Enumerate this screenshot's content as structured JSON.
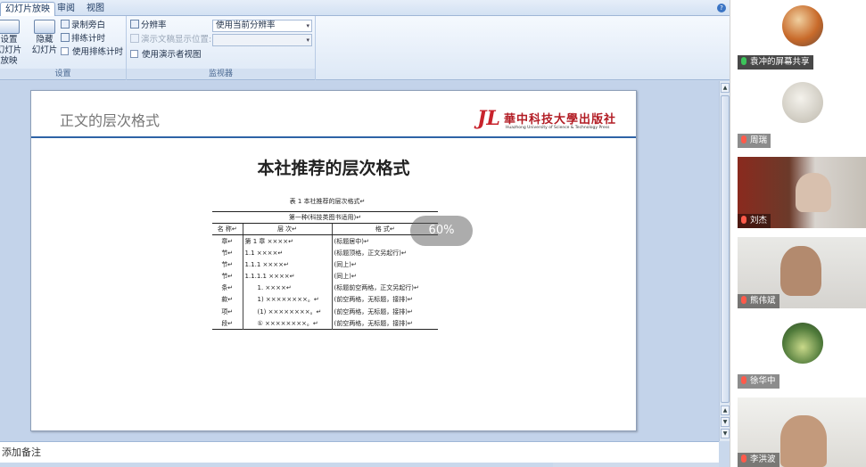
{
  "ribbon": {
    "tabs": [
      "幻灯片放映",
      "审阅",
      "视图"
    ],
    "help_label": "?",
    "setup_group": {
      "setup_show_label": "设置\n幻灯片放映",
      "hide_slide_label": "隐藏\n幻灯片",
      "record_narration": "录制旁白",
      "rehearse_timings": "排练计时",
      "use_rehearsed_timings": "使用排练计时",
      "group_label": "设置"
    },
    "monitor_group": {
      "resolution_label": "分辨率",
      "resolution_value": "使用当前分辨率",
      "show_on_label": "演示文稿显示位置:",
      "presenter_view_label": "使用演示者视图",
      "group_label": "监视器"
    }
  },
  "slide": {
    "header_title": "正文的层次格式",
    "logo_mark": "JL",
    "logo_cn": "華中科技大學出版社",
    "logo_en": "Huazhong University of Science & Technology Press",
    "main_title": "本社推荐的层次格式",
    "doc": {
      "caption": "表 1  本社推荐的层次格式↵",
      "span_row": "第一种(科技类图书适用)↵",
      "headers": [
        "名  称↵",
        "层  次↵",
        "格  式↵"
      ],
      "rows": [
        [
          "章↵",
          "第 1 章 ××××↵",
          "(标题居中)↵"
        ],
        [
          "节↵",
          "1.1 ××××↵",
          "(标题顶格，正文另起行)↵"
        ],
        [
          "节↵",
          "1.1.1 ××××↵",
          "(同上)↵"
        ],
        [
          "节↵",
          "1.1.1.1 ××××↵",
          "(同上)↵"
        ],
        [
          "条↵",
          "1. ××××↵",
          "(标题前空两格，正文另起行)↵"
        ],
        [
          "款↵",
          "1) ××××××××。↵",
          "(前空两格，无标题，接排)↵"
        ],
        [
          "项↵",
          "(1) ××××××××。↵",
          "(前空两格，无标题，接排)↵"
        ],
        [
          "段↵",
          "① ××××××××。↵",
          "(前空两格，无标题，接排)↵"
        ]
      ]
    },
    "zoom_badge": "60%"
  },
  "notes": {
    "placeholder": "添加备注"
  },
  "meeting": {
    "participants": [
      {
        "name": "袁冲的屏幕共享",
        "mic": "green",
        "sharing": true
      },
      {
        "name": "周瑞",
        "mic": "red"
      },
      {
        "name": "刘杰",
        "mic": "red"
      },
      {
        "name": "熊伟斌",
        "mic": "red"
      },
      {
        "name": "徐华中",
        "mic": "red"
      },
      {
        "name": "李洪波",
        "mic": "red"
      }
    ]
  },
  "colors": {
    "accent_blue": "#2e63a6",
    "logo_red": "#c8232c",
    "mic_muted": "#ff5a4a",
    "mic_active": "#3cc45a"
  }
}
